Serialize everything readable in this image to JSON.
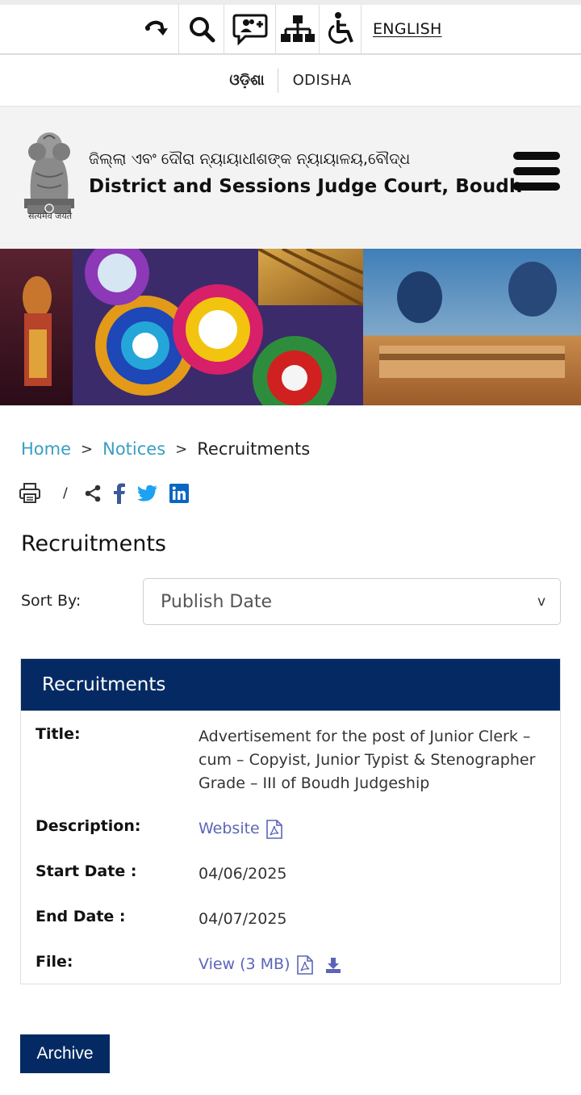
{
  "topbar": {
    "icons": [
      "skip-to-content-icon",
      "search-icon",
      "feedback-icon",
      "sitemap-icon",
      "accessibility-icon"
    ],
    "language_link": "ENGLISH"
  },
  "language_row": {
    "odia": "ଓଡ଼ିଶା",
    "odisha": "ODISHA"
  },
  "header": {
    "title_odia": "ଜିଲ୍ଲା ଏବଂ ଦୌରା ନ୍ୟାୟାଧୀଶଙ୍କ ନ୍ୟାୟାଳୟ,ବୌଦ୍ଧ",
    "title_en": "District and Sessions Judge Court, Boudh",
    "emblem_motto": "सत्यमेव जयते"
  },
  "breadcrumb": {
    "home": "Home",
    "notices": "Notices",
    "separator": ">",
    "current": "Recruitments"
  },
  "share": {
    "slash": "/",
    "icons": [
      "print-icon",
      "share-icon",
      "facebook-icon",
      "twitter-icon",
      "linkedin-icon"
    ]
  },
  "page_title": "Recruitments",
  "sort": {
    "label": "Sort By:",
    "selected": "Publish Date",
    "chevron": "v"
  },
  "card": {
    "heading": "Recruitments",
    "title_label": "Title:",
    "title_value": "Advertisement for the post of Junior Clerk – cum – Copyist, Junior Typist & Stenographer Grade – III of Boudh Judgeship",
    "description_label": "Description:",
    "description_link": "Website",
    "start_label": "Start Date :",
    "start_value": "04/06/2025",
    "end_label": "End Date :",
    "end_value": "04/07/2025",
    "file_label": "File:",
    "file_link": "View (3 MB)"
  },
  "archive_button": "Archive",
  "colors": {
    "navy": "#052a63",
    "link_blue": "#3a9ec1",
    "link_purple": "#5b65b8",
    "header_bg": "#f3f3f3"
  }
}
